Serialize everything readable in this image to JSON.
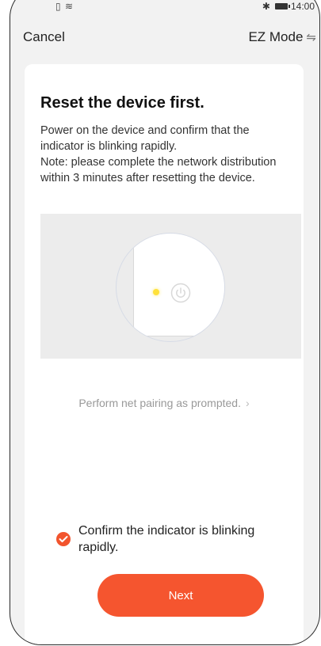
{
  "status_bar": {
    "left_icons": "🗎≄",
    "time": "14:00"
  },
  "nav": {
    "cancel_label": "Cancel",
    "mode_label": "EZ Mode",
    "mode_icon": "swap-icon"
  },
  "content": {
    "title": "Reset the device first.",
    "description": "Power on the device and confirm that the indicator is blinking rapidly.\nNote: please complete the network distribution within 3 minutes after resetting the device.",
    "prompt_link": "Perform net pairing as prompted.",
    "confirm_text": "Confirm the indicator is blinking rapidly.",
    "confirm_checked": true,
    "next_label": "Next"
  },
  "colors": {
    "accent": "#f5552f",
    "indicator": "#ffe13a"
  }
}
